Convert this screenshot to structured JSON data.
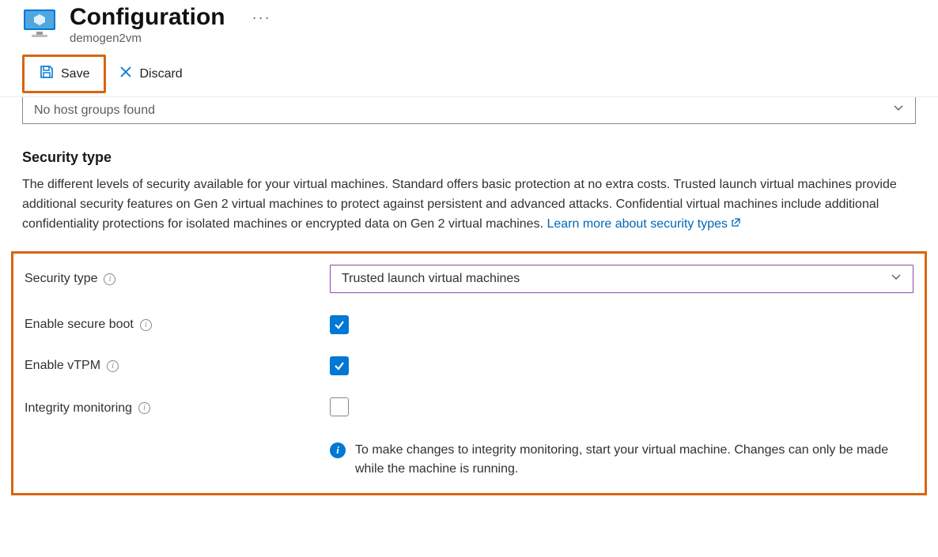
{
  "header": {
    "title": "Configuration",
    "subtitle": "demogen2vm",
    "more_label": "..."
  },
  "toolbar": {
    "save_label": "Save",
    "discard_label": "Discard"
  },
  "host_dropdown": {
    "text": "No host groups found"
  },
  "section": {
    "title": "Security type",
    "description": "The different levels of security available for your virtual machines. Standard offers basic protection at no extra costs. Trusted launch virtual machines provide additional security features on Gen 2 virtual machines to protect against persistent and advanced attacks. Confidential virtual machines include additional confidentiality protections for isolated machines or encrypted data on Gen 2 virtual machines. ",
    "link_text": "Learn more about security types"
  },
  "form": {
    "security_type": {
      "label": "Security type",
      "value": "Trusted launch virtual machines"
    },
    "secure_boot": {
      "label": "Enable secure boot",
      "checked": true
    },
    "vtpm": {
      "label": "Enable vTPM",
      "checked": true
    },
    "integrity": {
      "label": "Integrity monitoring",
      "checked": false
    },
    "note": "To make changes to integrity monitoring, start your virtual machine. Changes can only be made while the machine is running."
  }
}
